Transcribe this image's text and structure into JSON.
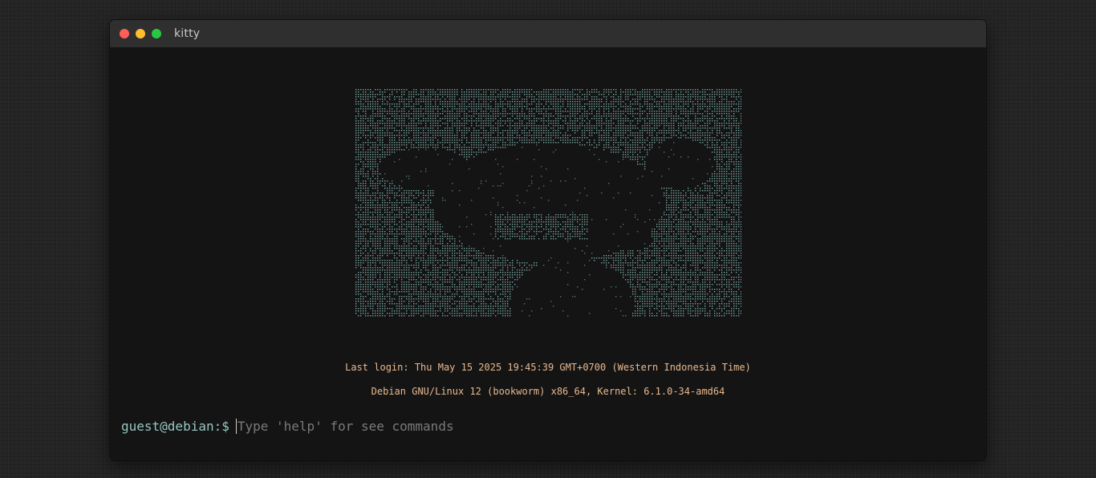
{
  "window": {
    "title": "kitty"
  },
  "terminal": {
    "last_login": "Last login: Thu May 15 2025 19:45:39 GMT+0700 (Western Indonesia Time)",
    "system_info": "Debian GNU/Linux 12 (bookworm) x86_64, Kernel: 6.1.0-34-amd64",
    "prompt": "guest@debian:$",
    "input_value": "",
    "input_placeholder": "Type 'help' for see commands"
  },
  "colors": {
    "ascii_art": "#7fb3ad",
    "motd": "#e8b88e",
    "prompt": "#97c7c0",
    "background": "#141414"
  },
  "icons": {
    "close": "traffic-light-red",
    "minimize": "traffic-light-yellow",
    "maximize": "traffic-light-green"
  }
}
